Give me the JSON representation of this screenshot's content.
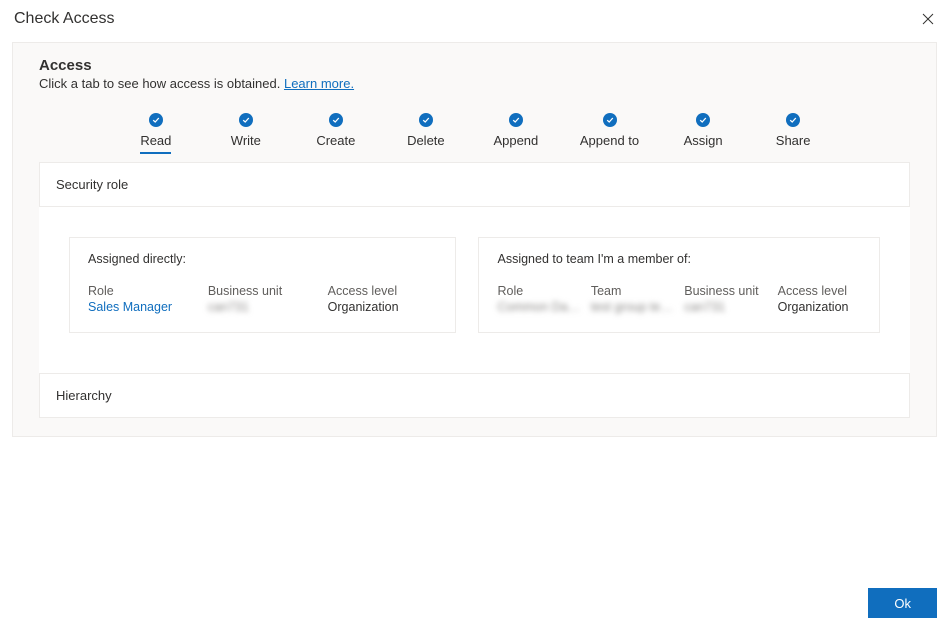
{
  "dialog": {
    "title": "Check Access"
  },
  "section": {
    "title": "Access",
    "subtitle_prefix": "Click a tab to see how access is obtained. ",
    "learn_more": "Learn more."
  },
  "tabs": [
    {
      "label": "Read",
      "active": true
    },
    {
      "label": "Write",
      "active": false
    },
    {
      "label": "Create",
      "active": false
    },
    {
      "label": "Delete",
      "active": false
    },
    {
      "label": "Append",
      "active": false
    },
    {
      "label": "Append to",
      "active": false
    },
    {
      "label": "Assign",
      "active": false
    },
    {
      "label": "Share",
      "active": false
    }
  ],
  "security_card": {
    "heading": "Security role"
  },
  "direct": {
    "caption": "Assigned directly:",
    "role_label": "Role",
    "role_value": "Sales Manager",
    "bu_label": "Business unit",
    "bu_value": "can731",
    "access_label": "Access level",
    "access_value": "Organization"
  },
  "team": {
    "caption": "Assigned to team I'm a member of:",
    "role_label": "Role",
    "role_value": "Common Data Servi…",
    "team_label": "Team",
    "team_value": "test group team",
    "bu_label": "Business unit",
    "bu_value": "can731",
    "access_label": "Access level",
    "access_value": "Organization"
  },
  "hierarchy_card": {
    "heading": "Hierarchy"
  },
  "footer": {
    "ok": "Ok"
  }
}
